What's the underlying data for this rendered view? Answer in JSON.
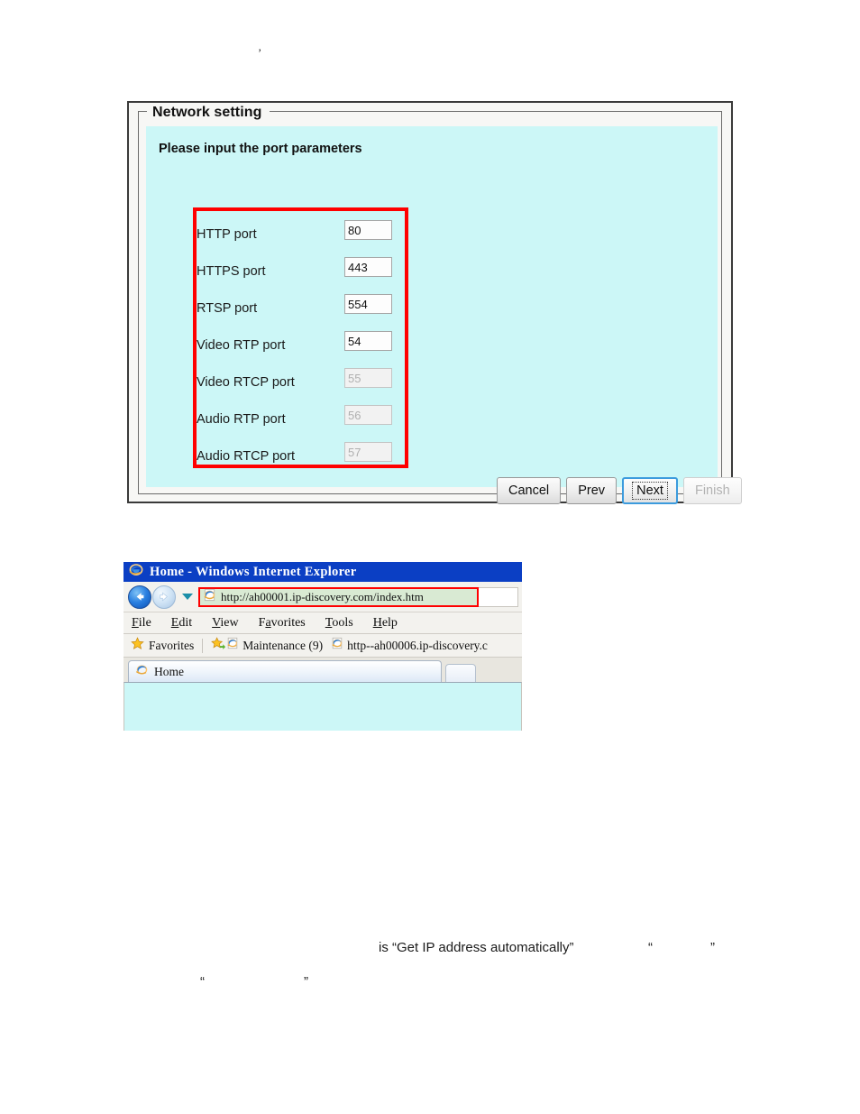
{
  "artifact": {
    "mark": "’"
  },
  "dialog": {
    "legend": "Network setting",
    "panel_title": "Please input the port parameters",
    "ports": [
      {
        "label": "HTTP port",
        "value": "80",
        "disabled": false
      },
      {
        "label": "HTTPS port",
        "value": "443",
        "disabled": false
      },
      {
        "label": "RTSP port",
        "value": "554",
        "disabled": false
      },
      {
        "label": "Video RTP port",
        "value": "54",
        "disabled": false
      },
      {
        "label": "Video RTCP port",
        "value": "55",
        "disabled": true
      },
      {
        "label": "Audio RTP port",
        "value": "56",
        "disabled": true
      },
      {
        "label": "Audio RTCP port",
        "value": "57",
        "disabled": true
      }
    ],
    "buttons": {
      "cancel": "Cancel",
      "prev": "Prev",
      "next": "Next",
      "finish": "Finish"
    },
    "colors": {
      "panel_background": "#ccf7f7",
      "annotation_box": "#ff0000",
      "focus_border": "#3c9bdd"
    }
  },
  "browser": {
    "title": "Home - Windows Internet Explorer",
    "address": "http://ah00001.ip-discovery.com/index.htm",
    "menu": [
      {
        "pre": "",
        "key": "F",
        "post": "ile"
      },
      {
        "pre": "",
        "key": "E",
        "post": "dit"
      },
      {
        "pre": "",
        "key": "V",
        "post": "iew"
      },
      {
        "pre": "F",
        "key": "a",
        "post": "vorites"
      },
      {
        "pre": "",
        "key": "T",
        "post": "ools"
      },
      {
        "pre": "",
        "key": "H",
        "post": "elp"
      }
    ],
    "favorites_label": "Favorites",
    "favorites": [
      {
        "label": "Maintenance (9)"
      },
      {
        "label": "http--ah00006.ip-discovery.c"
      }
    ],
    "tab": "Home",
    "colors": {
      "titlebar": "#0b3fc4",
      "address_highlight": "#ff0000",
      "content_background": "#ccf7f7"
    }
  },
  "page_text": {
    "auto_ip_line": "is “Get IP address automatically”",
    "quote_open": "“",
    "quote_close": "”"
  }
}
